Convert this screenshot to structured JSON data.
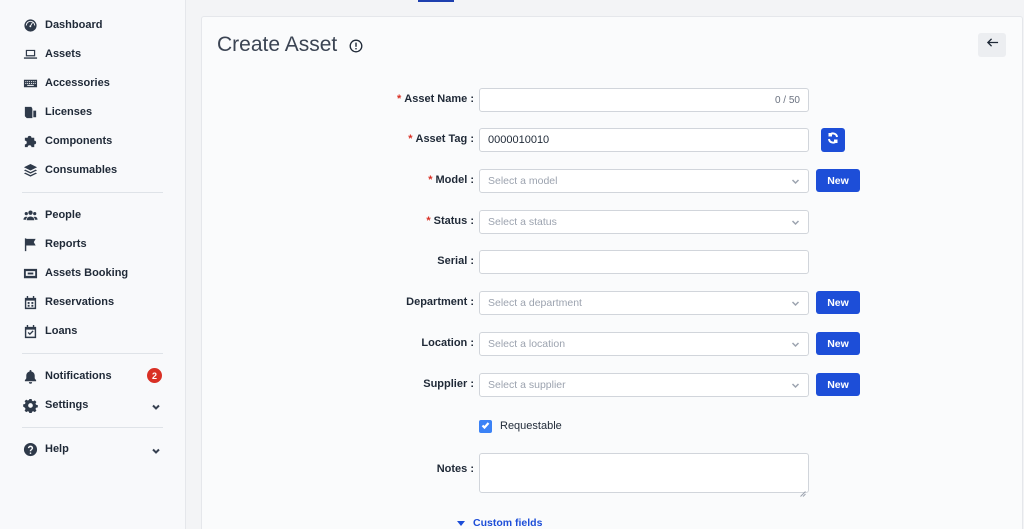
{
  "sidebar": {
    "items": [
      {
        "label": "Dashboard",
        "icon": "dashboard-icon"
      },
      {
        "label": "Assets",
        "icon": "laptop-icon"
      },
      {
        "label": "Accessories",
        "icon": "keyboard-icon"
      },
      {
        "label": "Licenses",
        "icon": "license-icon"
      },
      {
        "label": "Components",
        "icon": "puzzle-icon"
      },
      {
        "label": "Consumables",
        "icon": "layers-icon"
      },
      {
        "label": "People",
        "icon": "people-icon"
      },
      {
        "label": "Reports",
        "icon": "flag-icon"
      },
      {
        "label": "Assets Booking",
        "icon": "booking-icon"
      },
      {
        "label": "Reservations",
        "icon": "calendar-icon"
      },
      {
        "label": "Loans",
        "icon": "calendar-check-icon"
      },
      {
        "label": "Notifications",
        "icon": "bell-icon",
        "badge": "2"
      },
      {
        "label": "Settings",
        "icon": "gear-icon"
      },
      {
        "label": "Help",
        "icon": "help-icon"
      }
    ]
  },
  "header": {
    "title": "Create Asset"
  },
  "form": {
    "asset_name": {
      "label": "Asset Name",
      "value": "",
      "counter": "0 / 50"
    },
    "asset_tag": {
      "label": "Asset Tag",
      "value": "0000010010"
    },
    "model": {
      "label": "Model",
      "placeholder": "Select a model"
    },
    "status": {
      "label": "Status",
      "placeholder": "Select a status"
    },
    "serial": {
      "label": "Serial",
      "value": ""
    },
    "department": {
      "label": "Department",
      "placeholder": "Select a department"
    },
    "location": {
      "label": "Location",
      "placeholder": "Select a location"
    },
    "supplier": {
      "label": "Supplier",
      "placeholder": "Select a supplier"
    },
    "requestable": {
      "label": "Requestable",
      "checked": true
    },
    "notes": {
      "label": "Notes",
      "value": ""
    },
    "new_label": "New",
    "label_suffix": ":",
    "custom_fields": "Custom fields"
  },
  "colors": {
    "primary": "#1d4ed8",
    "required": "#d93025",
    "badge": "#d93025"
  }
}
